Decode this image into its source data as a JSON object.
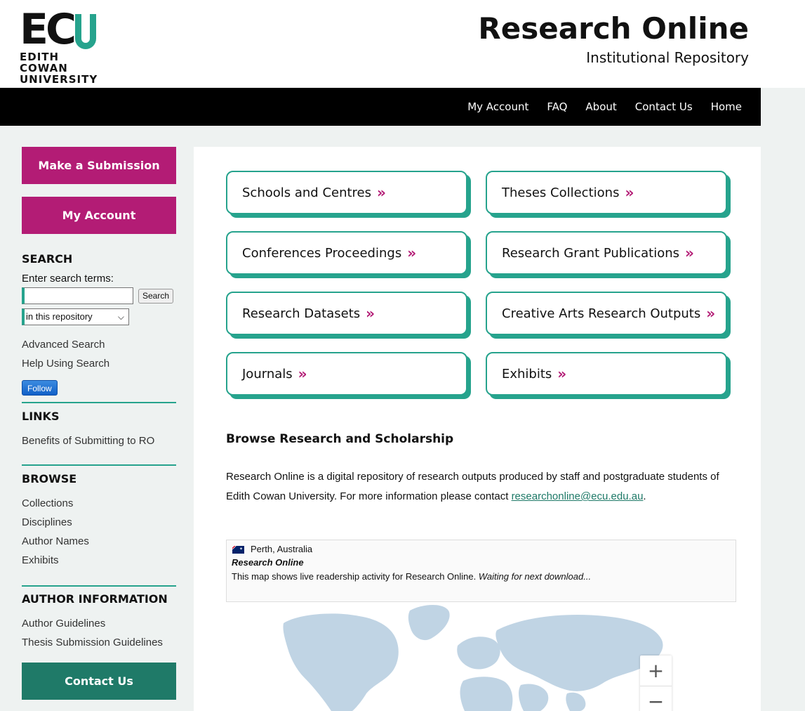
{
  "header": {
    "logo_mark": "EC",
    "logo_line1": "EDITH COWAN",
    "logo_line2": "UNIVERSITY",
    "title": "Research Online",
    "subtitle": "Institutional Repository"
  },
  "nav": [
    {
      "label": "My Account"
    },
    {
      "label": "FAQ"
    },
    {
      "label": "About"
    },
    {
      "label": "Contact Us"
    },
    {
      "label": "Home"
    }
  ],
  "sidebar": {
    "submit_label": "Make a Submission",
    "account_label": "My Account",
    "search": {
      "heading": "SEARCH",
      "prompt": "Enter search terms:",
      "input_value": "",
      "button_label": "Search",
      "scope_selected": "in this repository",
      "advanced": "Advanced Search",
      "help": "Help Using Search",
      "follow_label": "Follow"
    },
    "links": {
      "heading": "LINKS",
      "items": [
        "Benefits of Submitting to RO"
      ]
    },
    "browse": {
      "heading": "BROWSE",
      "items": [
        "Collections",
        "Disciplines",
        "Author Names",
        "Exhibits"
      ]
    },
    "author_info": {
      "heading": "AUTHOR INFORMATION",
      "items": [
        "Author Guidelines",
        "Thesis Submission Guidelines"
      ]
    },
    "contact_label": "Contact Us"
  },
  "tiles": [
    {
      "label": "Schools and Centres"
    },
    {
      "label": "Theses Collections"
    },
    {
      "label": "Conferences Proceedings"
    },
    {
      "label": "Research Grant Publications"
    },
    {
      "label": "Research Datasets"
    },
    {
      "label": "Creative Arts Research Outputs"
    },
    {
      "label": "Journals"
    },
    {
      "label": "Exhibits"
    }
  ],
  "tile_arrow": "»",
  "browse": {
    "heading": "Browse Research and Scholarship",
    "intro_text": "Research Online is a digital repository of research outputs produced by staff and postgraduate students of Edith Cowan University. For more information please contact ",
    "contact_email": "researchonline@ecu.edu.au",
    "intro_end": "."
  },
  "readership_map": {
    "location": "Perth, Australia",
    "title": "Research Online",
    "description": "This map shows live readership activity for Research Online. ",
    "status": "Waiting for next download...",
    "zoom_in": "+",
    "zoom_out": "−"
  },
  "colors": {
    "accent_green": "#26a38d",
    "magenta": "#b31c75",
    "dark_green": "#1f7a68",
    "map_land": "#c0d4e4"
  },
  "icons": {
    "tile_arrow": "double-chevron-right-icon",
    "flag": "australia-flag-icon",
    "select": "chevron-down-icon"
  }
}
